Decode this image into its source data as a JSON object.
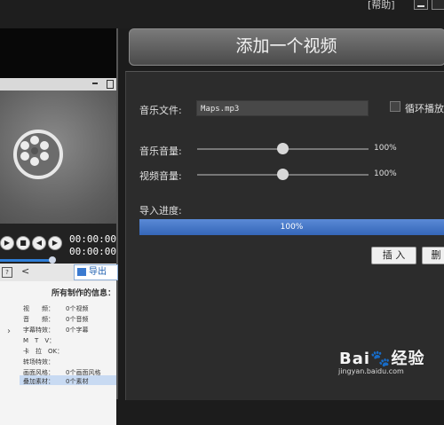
{
  "window": {
    "help_menu": "[帮助]"
  },
  "player": {
    "timecode1": "00:00:00",
    "timecode2": "00:00:00",
    "export_label": "导出"
  },
  "info_panel": {
    "title": "所有制作的信息：",
    "rows": [
      {
        "label": "视　　频：",
        "value": "0个视频"
      },
      {
        "label": "音　　频：",
        "value": "0个音频"
      },
      {
        "label": "字幕特效：",
        "value": "0个字幕"
      },
      {
        "label": "M　T　V：",
        "value": ""
      },
      {
        "label": "卡　拉　OK：",
        "value": ""
      },
      {
        "label": "转场特效：",
        "value": ""
      },
      {
        "label": "画面风格：",
        "value": "0个画面风格"
      },
      {
        "label": "叠加素材：",
        "value": "0个素材"
      }
    ]
  },
  "dialog": {
    "title": "添加一个视频",
    "music_file_label": "音乐文件:",
    "music_file_value": "Maps.mp3",
    "loop_label": "循环播放",
    "music_volume_label": "音乐音量:",
    "music_volume_value": "100%",
    "music_volume_level": 1.0,
    "video_volume_label": "视频音量:",
    "video_volume_value": "100%",
    "video_volume_level": 1.0,
    "import_progress_label": "导入进度:",
    "import_progress_text": "100%",
    "import_progress": 1.0,
    "insert_label": "插 入",
    "delete_label": "删"
  },
  "watermark": {
    "logo": "Bai🐾经验",
    "url": "jingyan.baidu.com"
  },
  "colors": {
    "progress": "#3f72c4",
    "dialog_bg": "#2c2c2c",
    "header": "#5a5a5a"
  }
}
